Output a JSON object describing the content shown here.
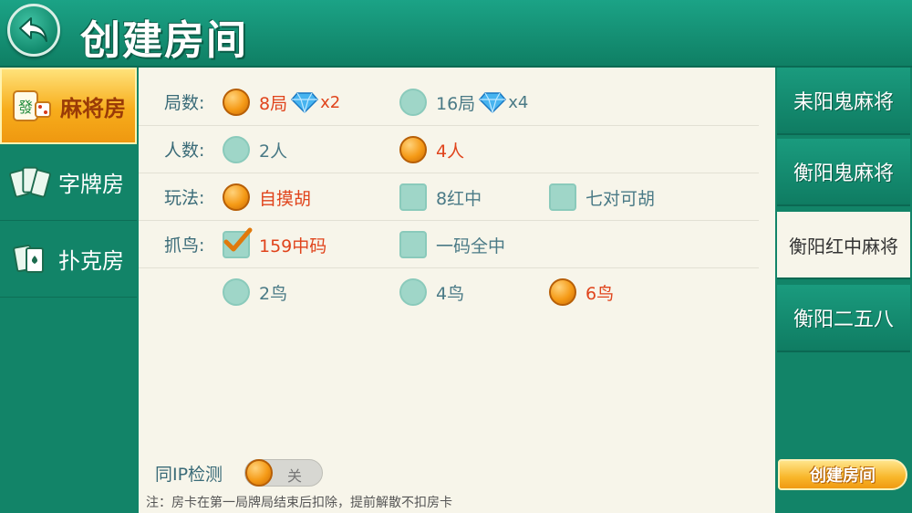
{
  "header": {
    "title": "创建房间"
  },
  "categories": [
    {
      "label": "麻将房",
      "icon": "mahjong-tile-icon",
      "active": true
    },
    {
      "label": "字牌房",
      "icon": "word-cards-icon",
      "active": false
    },
    {
      "label": "扑克房",
      "icon": "poker-cards-icon",
      "active": false
    }
  ],
  "options": {
    "rounds": {
      "label": "局数:",
      "choices": [
        {
          "text": "8局",
          "cost": "x2",
          "selected": true
        },
        {
          "text": "16局",
          "cost": "x4",
          "selected": false
        }
      ]
    },
    "players": {
      "label": "人数:",
      "choices": [
        {
          "text": "2人",
          "selected": false
        },
        {
          "text": "4人",
          "selected": true
        }
      ]
    },
    "play": {
      "label": "玩法:",
      "choices": [
        {
          "text": "自摸胡",
          "selected": true
        },
        {
          "text": "8红中",
          "selected": false
        },
        {
          "text": "七对可胡",
          "selected": false
        }
      ]
    },
    "birds": {
      "label": "抓鸟:",
      "choices": [
        {
          "text": "159中码",
          "selected": true
        },
        {
          "text": "一码全中",
          "selected": false
        }
      ],
      "counts": [
        {
          "text": "2鸟",
          "selected": false
        },
        {
          "text": "4鸟",
          "selected": false
        },
        {
          "text": "6鸟",
          "selected": true
        }
      ]
    }
  },
  "ip_check": {
    "label": "同IP检测",
    "state": "关"
  },
  "note": "注：房卡在第一局牌局结束后扣除，提前解散不扣房卡",
  "rule_tabs": [
    {
      "label": "耒阳鬼麻将",
      "active": false
    },
    {
      "label": "衡阳鬼麻将",
      "active": false
    },
    {
      "label": "衡阳红中麻将",
      "active": true
    },
    {
      "label": "衡阳二五八",
      "active": false
    }
  ],
  "create_button": {
    "label": "创建房间"
  },
  "colors": {
    "accent": "#f59a16",
    "selected_text": "#e0441c",
    "panel_bg": "#f7f5ea",
    "green_bg": "#13866a"
  }
}
